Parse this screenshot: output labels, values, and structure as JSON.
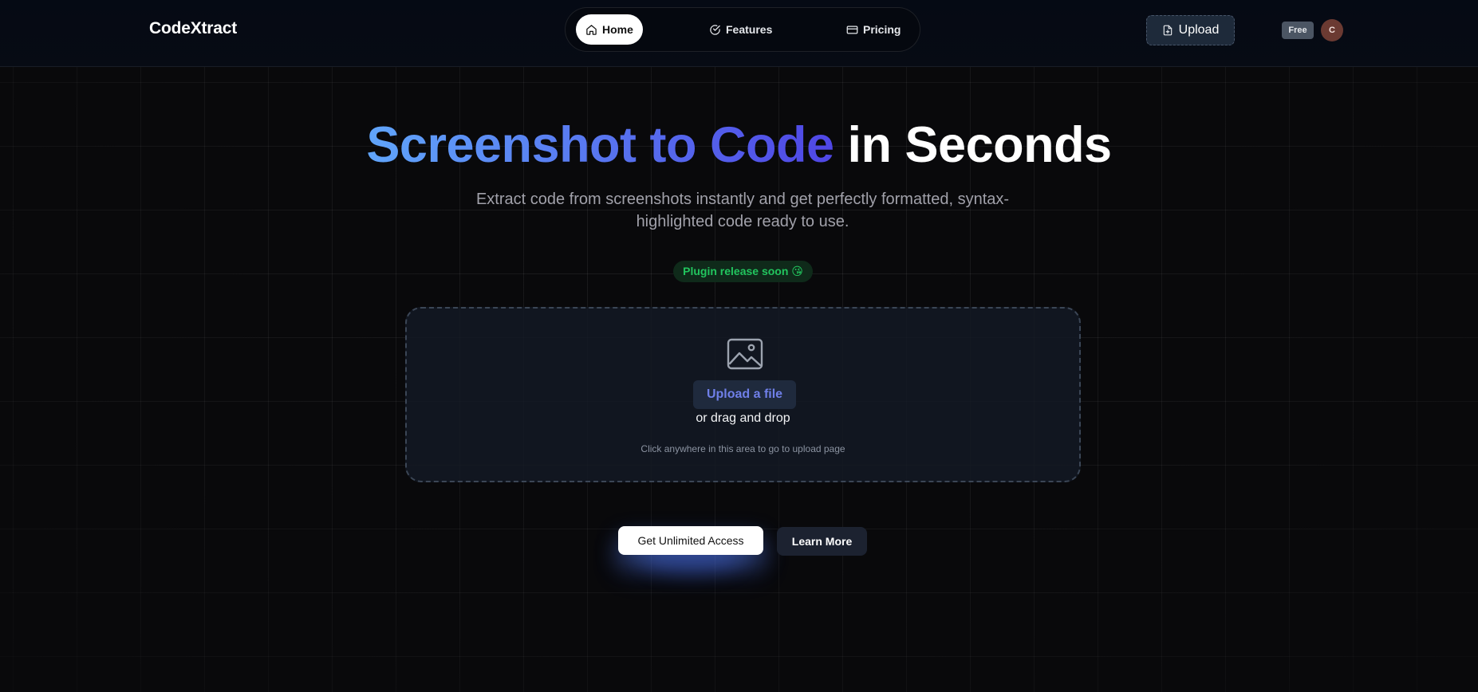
{
  "header": {
    "logo": "CodeXtract",
    "nav": [
      {
        "label": "Home",
        "icon": "home-icon",
        "active": true
      },
      {
        "label": "Features",
        "icon": "check-circle-icon",
        "active": false
      },
      {
        "label": "Pricing",
        "icon": "credit-card-icon",
        "active": false
      }
    ],
    "upload_label": "Upload",
    "upload_icon": "file-icon",
    "plan_badge": "Free",
    "avatar_initial": "C"
  },
  "hero": {
    "title_gradient": "Screenshot to Code",
    "title_plain": "in Seconds",
    "subtitle": "Extract code from screenshots instantly and get perfectly formatted, syntax-highlighted code ready to use.",
    "release_badge": "Plugin release soon 😘"
  },
  "dropzone": {
    "icon": "image-icon",
    "upload_button": "Upload a file",
    "drag_text": "or drag and drop",
    "hint": "Click anywhere in this area to go to upload page"
  },
  "cta": {
    "primary": "Get Unlimited Access",
    "secondary": "Learn More"
  },
  "colors": {
    "background": "#09090b",
    "gradient_start": "#60a5fa",
    "gradient_end": "#4f46e5",
    "badge_green": "#22c55e",
    "link_accent": "#6f7fe8"
  }
}
